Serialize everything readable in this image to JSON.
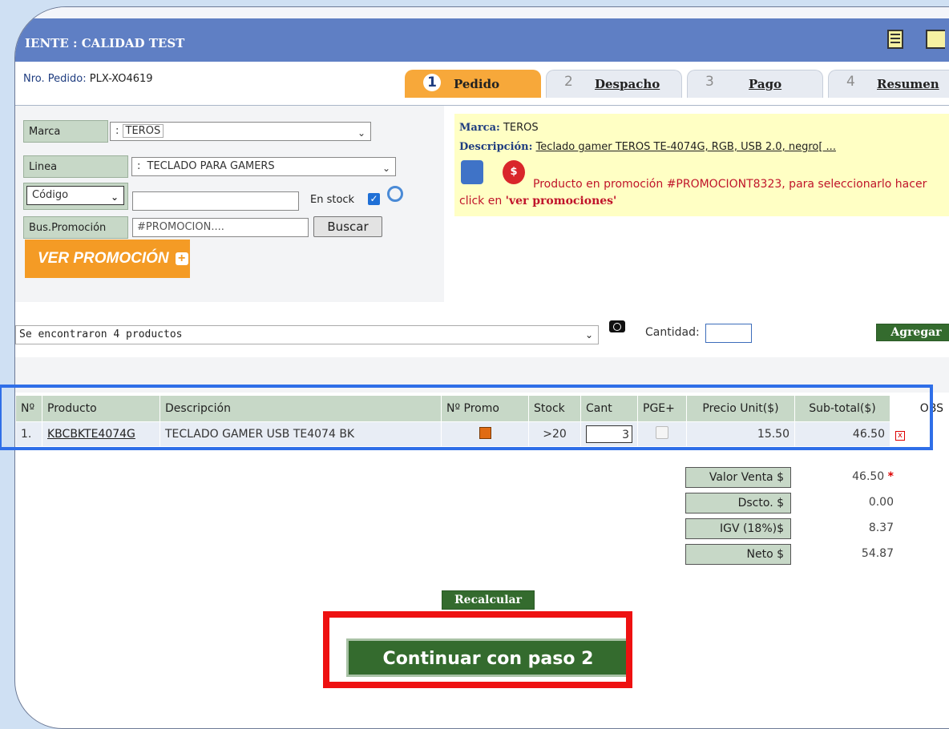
{
  "header": {
    "title": "IENTE : CALIDAD TEST"
  },
  "order": {
    "label": "Nro. Pedido:",
    "value": "PLX-XO4619"
  },
  "tabs": [
    {
      "num": "1",
      "label": "Pedido",
      "active": true
    },
    {
      "num": "2",
      "label": "Despacho",
      "active": false
    },
    {
      "num": "3",
      "label": "Pago",
      "active": false
    },
    {
      "num": "4",
      "label": "Resumen",
      "active": false
    }
  ],
  "filters": {
    "marca_label": "Marca",
    "marca_value": "TEROS",
    "linea_label": "Linea",
    "linea_value": "TECLADO PARA GAMERS",
    "codigo_select": "Código",
    "codigo_value": "",
    "stock_label": "En stock",
    "stock_checked": true,
    "promo_label": "Bus.Promoción",
    "promo_placeholder": "#PROMOCION....",
    "buscar": "Buscar",
    "colon": ":"
  },
  "ver_promocion": "VER PROMOCIÓN",
  "info": {
    "marca_key": "Marca:",
    "marca_val": "TEROS",
    "desc_key": "Descripción:",
    "desc_val": "Teclado gamer TEROS TE-4074G, RGB, USB 2.0, negro[ ...",
    "promo_line1": "Producto en promoción #PROMOCIONT8323, para seleccionarlo hacer",
    "promo_line2a": "click en ",
    "promo_line2b": "'ver promociones'"
  },
  "results": {
    "text": "Se encontraron 4 productos"
  },
  "cantidad_label": "Cantidad:",
  "agregar": "Agregar",
  "table": {
    "headers": [
      "Nº",
      "Producto",
      "Descripción",
      "Nº Promo",
      "Stock",
      "Cant",
      "PGE+",
      "Precio Unit($)",
      "Sub-total($)",
      "OBS"
    ],
    "row": {
      "n": "1.",
      "producto": "KBCBKTE4074G",
      "descripcion": "TECLADO GAMER USB TE4074 BK",
      "stock": ">20",
      "cant": "3",
      "precio": "15.50",
      "subtotal": "46.50"
    }
  },
  "totals": [
    {
      "label": "Valor Venta $",
      "value": "46.50"
    },
    {
      "label": "Dscto. $",
      "value": "0.00"
    },
    {
      "label": "IGV (18%)$",
      "value": "8.37"
    },
    {
      "label": "Neto $",
      "value": "54.87"
    }
  ],
  "required_mark": "*",
  "recalcular": "Recalcular",
  "continuar": "Continuar con paso 2",
  "colors": {
    "header_blue": "#5f7fc4",
    "orange": "#f7a83a",
    "green": "#346b2e",
    "highlight_blue": "#2f6fe8",
    "highlight_red": "#ee1111"
  }
}
